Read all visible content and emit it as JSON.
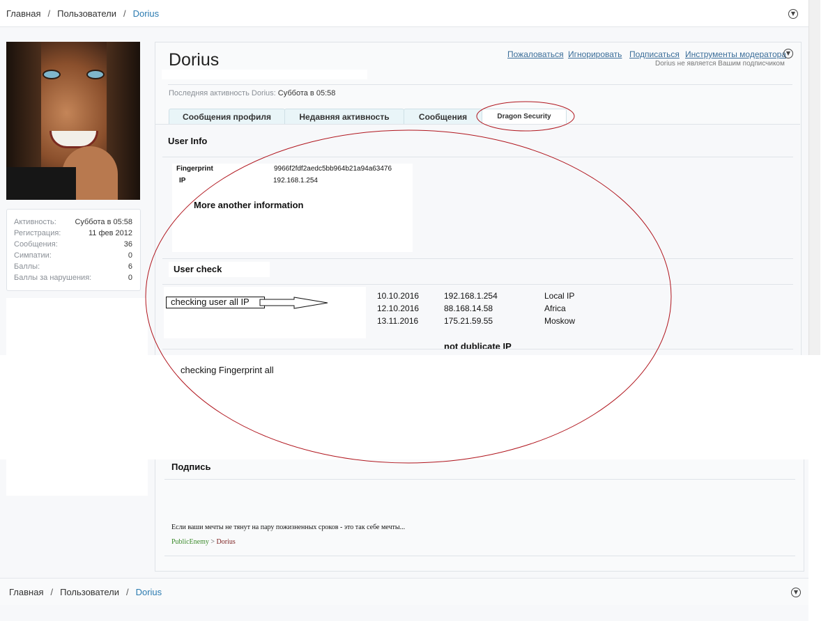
{
  "breadcrumb": {
    "items": [
      "Главная",
      "Пользователи",
      "Dorius"
    ],
    "separator": "/"
  },
  "profile": {
    "username": "Dorius",
    "last_activity_label": "Последняя активность Dorius:",
    "last_activity_value": "Суббота в 05:58",
    "actions": [
      "Пожаловаться",
      "Игнорировать",
      "Подписаться",
      "Инструменты модератора"
    ],
    "follow_note": "Dorius не является Вашим подписчиком"
  },
  "stats": [
    {
      "label": "Активность:",
      "value": "Суббота в 05:58"
    },
    {
      "label": "Регистрация:",
      "value": "11 фев 2012"
    },
    {
      "label": "Сообщения:",
      "value": "36"
    },
    {
      "label": "Симпатии:",
      "value": "0"
    },
    {
      "label": "Баллы:",
      "value": "6"
    },
    {
      "label": "Баллы за нарушения:",
      "value": "0"
    }
  ],
  "tabs": [
    "Сообщения профиля",
    "Недавняя активность",
    "Сообщения",
    "Dragon Security"
  ],
  "security": {
    "user_info_title": "User Info",
    "fingerprint_label": "Fingerprint",
    "fingerprint_value": "9966f2fdf2aedc5bb964b21a94a63476",
    "ip_label": "IP",
    "ip_value": "192.168.1.254",
    "more_info": "More another information",
    "user_check_title": "User check",
    "check_ip_label": "checking user all IP",
    "ip_history": [
      {
        "date": "10.10.2016",
        "ip": "192.168.1.254",
        "location": "Local IP"
      },
      {
        "date": "12.10.2016",
        "ip": "88.168.14.58",
        "location": "Africa"
      },
      {
        "date": "13.11.2016",
        "ip": "175.21.59.55",
        "location": "Moskow"
      }
    ],
    "not_duplicate": "not dublicate IP",
    "check_fingerprint_label": "checking Fingerprint all"
  },
  "signature": {
    "title": "Подпись",
    "text": "Если ваши мечты не тянут на пару пожизненных сроков - это так себе мечты...",
    "link1": "PublicEnemy",
    "link_sep": " > ",
    "link2": "Dorius"
  },
  "icons": {
    "dropdown": "chevron-down-circle-icon"
  },
  "colors": {
    "annotation_red": "#b0141c",
    "link_blue": "#3a6d99",
    "breadcrumb_current": "#2b7bb0",
    "tab_bg": "#e9f5f8"
  }
}
